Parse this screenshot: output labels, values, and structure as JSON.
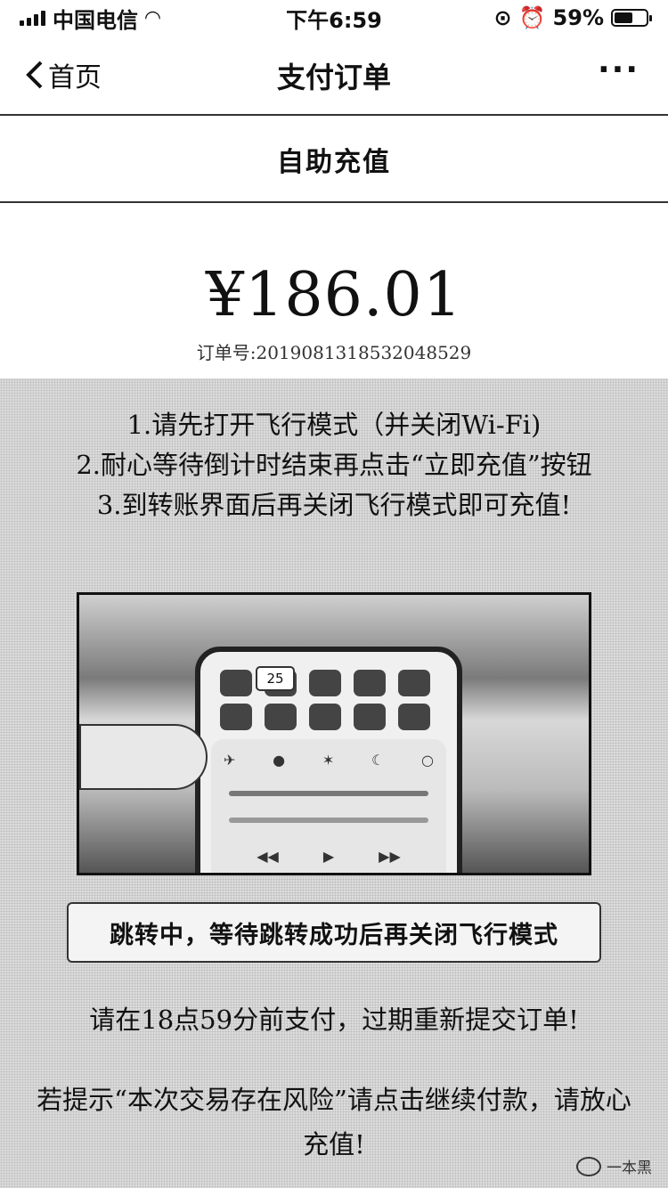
{
  "status_bar": {
    "carrier": "中国电信",
    "time": "下午6:59",
    "battery_percent": "59%",
    "battery_level": 0.59
  },
  "nav": {
    "back_label": "首页",
    "title": "支付订单",
    "more": "···"
  },
  "section_title": "自助充值",
  "payment": {
    "amount": "¥186.01",
    "order_no": "订单号:2019081318532048529"
  },
  "instructions": [
    "1.请先打开飞行模式（并关闭Wi-Fi)",
    "2.耐心等待倒计时结束再点击“立即充值”按钮",
    "3.到转账界面后再关闭飞行模式即可充值!"
  ],
  "demo_image": {
    "badge": "25"
  },
  "caption": "跳转中，等待跳转成功后再关闭飞行模式",
  "deadline_note": "请在18点59分前支付，过期重新提交订单!",
  "risk_note": "若提示“本次交易存在风险”请点击继续付款，请放心充值!",
  "watermark": "一本黑"
}
